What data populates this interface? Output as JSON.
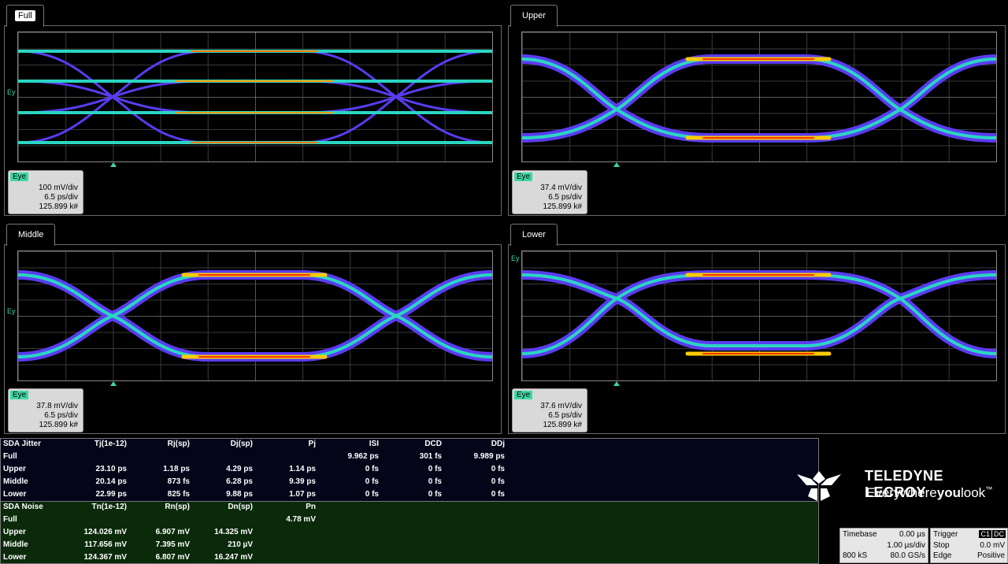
{
  "panels": [
    {
      "tab": "Full",
      "active": true,
      "eye_label": "Ey",
      "desc": {
        "tag": "Eye",
        "vdiv": "100 mV/div",
        "tdiv": "6.5 ps/div",
        "count": "125.899 k#"
      }
    },
    {
      "tab": "Upper",
      "active": false,
      "eye_label": "",
      "desc": {
        "tag": "Eye",
        "vdiv": "37.4 mV/div",
        "tdiv": "6.5 ps/div",
        "count": "125.899 k#"
      }
    },
    {
      "tab": "Middle",
      "active": false,
      "eye_label": "Ey",
      "desc": {
        "tag": "Eye",
        "vdiv": "37.8 mV/div",
        "tdiv": "6.5 ps/div",
        "count": "125.899 k#"
      }
    },
    {
      "tab": "Lower",
      "active": false,
      "eye_label": "Ey",
      "desc": {
        "tag": "Eye",
        "vdiv": "37.6 mV/div",
        "tdiv": "6.5 ps/div",
        "count": "125.899 k#"
      }
    }
  ],
  "jitter": {
    "headers": [
      "SDA Jitter",
      "Tj(1e-12)",
      "Rj(sp)",
      "Dj(sp)",
      "Pj",
      "ISI",
      "DCD",
      "DDj"
    ],
    "rows": [
      [
        "Full",
        "",
        "",
        "",
        "",
        "9.962 ps",
        "301 fs",
        "9.989 ps"
      ],
      [
        "Upper",
        "23.10 ps",
        "1.18 ps",
        "4.29 ps",
        "1.14 ps",
        "0 fs",
        "0 fs",
        "0 fs"
      ],
      [
        "Middle",
        "20.14 ps",
        "873 fs",
        "6.28 ps",
        "9.39 ps",
        "0 fs",
        "0 fs",
        "0 fs"
      ],
      [
        "Lower",
        "22.99 ps",
        "825 fs",
        "9.88 ps",
        "1.07 ps",
        "0 fs",
        "0 fs",
        "0 fs"
      ]
    ]
  },
  "noise": {
    "headers": [
      "SDA Noise",
      "Tn(1e-12)",
      "Rn(sp)",
      "Dn(sp)",
      "Pn"
    ],
    "rows": [
      [
        "Full",
        "",
        "",
        "",
        "4.78 mV"
      ],
      [
        "Upper",
        "124.026 mV",
        "6.907 mV",
        "14.325 mV",
        ""
      ],
      [
        "Middle",
        "117.656 mV",
        "7.395 mV",
        "210 µV",
        ""
      ],
      [
        "Lower",
        "124.367 mV",
        "6.807 mV",
        "16.247 mV",
        ""
      ]
    ]
  },
  "logo": {
    "brand": "TELEDYNE LECROY",
    "tagline_a": "Everywhere",
    "tagline_b": "you",
    "tagline_c": "look",
    "tm": "™"
  },
  "timebase": {
    "label": "Timebase",
    "delay": "0.00 µs",
    "tdiv": "1.00 µs/div",
    "samples": "800 kS",
    "rate": "80.0 GS/s"
  },
  "trigger": {
    "label": "Trigger",
    "chan": "C1",
    "coupling": "DC",
    "mode": "Stop",
    "level": "0.0 mV",
    "type": "Edge",
    "slope": "Positive"
  },
  "colors": {
    "accent": "#3fd6a6",
    "noise_bg": "#0a2a0a",
    "jitter_bg": "#05051a"
  }
}
